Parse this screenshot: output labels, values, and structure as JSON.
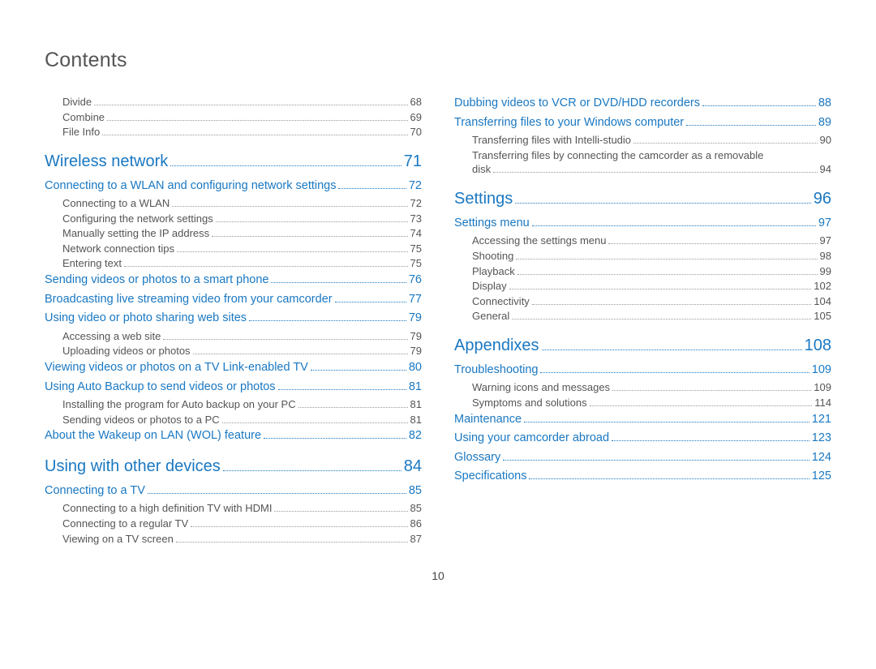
{
  "title": "Contents",
  "footer_page": "10",
  "left": [
    {
      "level": 3,
      "label": "Divide",
      "page": "68"
    },
    {
      "level": 3,
      "label": "Combine",
      "page": "69"
    },
    {
      "level": 3,
      "label": "File Info",
      "page": "70"
    },
    {
      "level": 1,
      "label": "Wireless network",
      "page": "71"
    },
    {
      "level": 2,
      "label": "Connecting to a WLAN and configuring network settings",
      "page": "72"
    },
    {
      "level": 3,
      "label": "Connecting to a WLAN",
      "page": "72"
    },
    {
      "level": 3,
      "label": "Configuring the network settings",
      "page": "73"
    },
    {
      "level": 3,
      "label": "Manually setting the IP address",
      "page": "74"
    },
    {
      "level": 3,
      "label": "Network connection tips",
      "page": "75"
    },
    {
      "level": 3,
      "label": "Entering text",
      "page": "75"
    },
    {
      "level": 2,
      "label": "Sending videos or photos to a smart phone",
      "page": "76"
    },
    {
      "level": 2,
      "label": "Broadcasting live streaming video from your camcorder",
      "page": "77"
    },
    {
      "level": 2,
      "label": "Using video or photo sharing web sites",
      "page": "79"
    },
    {
      "level": 3,
      "label": "Accessing a web site",
      "page": "79"
    },
    {
      "level": 3,
      "label": "Uploading videos or photos",
      "page": "79"
    },
    {
      "level": 2,
      "label": "Viewing videos or photos on a TV Link-enabled TV",
      "page": "80"
    },
    {
      "level": 2,
      "label": "Using Auto Backup to send videos or photos",
      "page": "81"
    },
    {
      "level": 3,
      "label": "Installing the program for Auto backup on your PC",
      "page": "81"
    },
    {
      "level": 3,
      "label": "Sending videos or photos to a PC",
      "page": "81"
    },
    {
      "level": 2,
      "label": "About the Wakeup on LAN (WOL) feature",
      "page": "82"
    },
    {
      "level": 1,
      "label": "Using with other devices",
      "page": "84"
    },
    {
      "level": 2,
      "label": "Connecting to a TV",
      "page": "85"
    },
    {
      "level": 3,
      "label": "Connecting to a high definition TV with HDMI",
      "page": "85"
    },
    {
      "level": 3,
      "label": "Connecting to a regular TV",
      "page": "86"
    },
    {
      "level": 3,
      "label": "Viewing on a TV screen",
      "page": "87"
    }
  ],
  "right": [
    {
      "level": 2,
      "label": "Dubbing videos to VCR or DVD/HDD recorders",
      "page": "88"
    },
    {
      "level": 2,
      "label": "Transferring files to your Windows computer",
      "page": "89"
    },
    {
      "level": 3,
      "label": "Transferring files with Intelli-studio",
      "page": "90"
    },
    {
      "level": 3,
      "label": "Transferring files by connecting the camcorder as a removable disk",
      "page": "94"
    },
    {
      "level": 1,
      "label": "Settings",
      "page": "96"
    },
    {
      "level": 2,
      "label": "Settings menu",
      "page": "97"
    },
    {
      "level": 3,
      "label": "Accessing the settings menu",
      "page": "97"
    },
    {
      "level": 3,
      "label": "Shooting",
      "page": "98"
    },
    {
      "level": 3,
      "label": "Playback",
      "page": "99"
    },
    {
      "level": 3,
      "label": "Display",
      "page": "102"
    },
    {
      "level": 3,
      "label": "Connectivity",
      "page": "104"
    },
    {
      "level": 3,
      "label": "General",
      "page": "105"
    },
    {
      "level": 1,
      "label": "Appendixes",
      "page": "108"
    },
    {
      "level": 2,
      "label": "Troubleshooting",
      "page": "109"
    },
    {
      "level": 3,
      "label": "Warning icons and messages",
      "page": "109"
    },
    {
      "level": 3,
      "label": "Symptoms and solutions",
      "page": "114"
    },
    {
      "level": 2,
      "label": "Maintenance",
      "page": "121"
    },
    {
      "level": 2,
      "label": "Using your camcorder abroad",
      "page": "123"
    },
    {
      "level": 2,
      "label": "Glossary",
      "page": "124"
    },
    {
      "level": 2,
      "label": "Specifications",
      "page": "125"
    }
  ]
}
